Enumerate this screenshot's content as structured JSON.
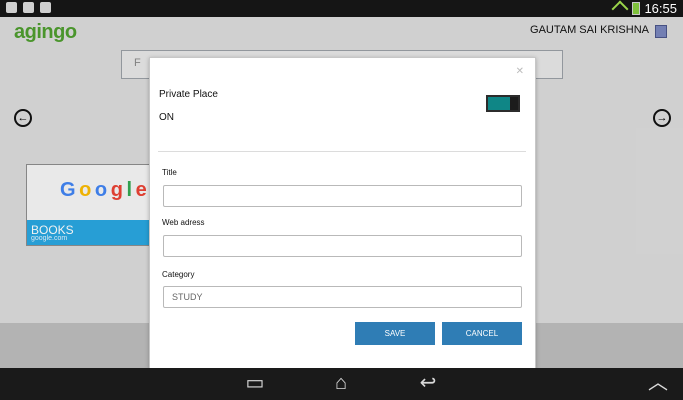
{
  "statusbar": {
    "time": "16:55"
  },
  "header": {
    "logo": "agingo",
    "user_name": "GAUTAM SAI KRISHNA"
  },
  "search": {
    "placeholder": "F"
  },
  "tile": {
    "doodle_text": [
      "G",
      "o",
      "o",
      "g",
      "l",
      "e"
    ],
    "title": "BOOKS",
    "url": "google.com"
  },
  "modal": {
    "private_label": "Private Place",
    "private_state": "ON",
    "fields": {
      "title_label": "Title",
      "web_label": "Web adress",
      "category_label": "Category",
      "category_value": "STUDY"
    },
    "buttons": {
      "save": "SAVE",
      "cancel": "CANCEL"
    }
  },
  "colors": {
    "accent_blue": "#2f7db5",
    "toggle_teal": "#0f8686",
    "logo_green": "#4f9e2f",
    "tile_blue": "#2aa7e1"
  }
}
